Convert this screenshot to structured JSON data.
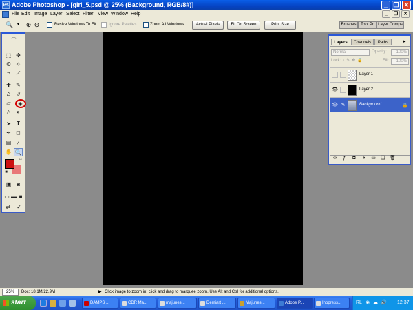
{
  "title": "Adobe Photoshop - [girl_5.psd @ 25% (Background, RGB/8#)]",
  "window_controls": {
    "minimize": "_",
    "restore": "❐",
    "close": "✕"
  },
  "menu": [
    "File",
    "Edit",
    "Image",
    "Layer",
    "Select",
    "Filter",
    "View",
    "Window",
    "Help"
  ],
  "options": {
    "resize_windows": "Resize Windows To Fit",
    "ignore_palettes": "Ignore Palettes",
    "zoom_all": "Zoom All Windows",
    "actual_pixels": "Actual Pixels",
    "fit_on_screen": "Fit On Screen",
    "print_size": "Print Size",
    "dock_tabs": [
      "Brushes",
      "Tool Pr",
      "Layer Comps"
    ]
  },
  "toolbox": {
    "foreground_color": "#cc1111",
    "background_color": "#e87878"
  },
  "layers_palette": {
    "tabs": [
      "Layers",
      "Channels",
      "Paths"
    ],
    "blend_mode": "Normal",
    "opacity_label": "Opacity:",
    "opacity_value": "100%",
    "lock_label": "Lock:",
    "fill_label": "Fill:",
    "fill_value": "100%",
    "layers": [
      {
        "name": "Layer 1",
        "visible": false,
        "selected": false
      },
      {
        "name": "Layer 2",
        "visible": true,
        "selected": false
      },
      {
        "name": "Background",
        "visible": true,
        "selected": true
      }
    ]
  },
  "status": {
    "zoom": "25%",
    "doc": "Doc: 18.1M/22.9M",
    "hint": "Click image to zoom in; click and drag to marquee zoom.  Use Alt and Ctrl for additional options."
  },
  "taskbar": {
    "start": "start",
    "tasks": [
      "DAMPS ...",
      "CDR Ma...",
      "majunes...",
      "Demiart ...",
      "Majunes...",
      "Adobe P...",
      "Inopress..."
    ],
    "tray_lang": "RL",
    "clock": "12:37"
  }
}
